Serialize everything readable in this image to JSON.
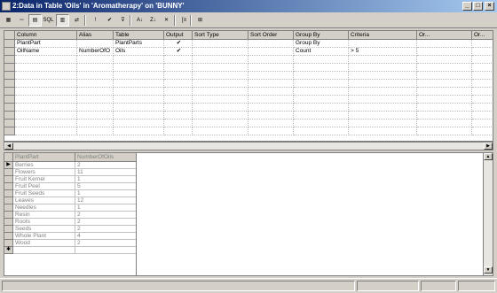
{
  "window": {
    "title": "2:Data in Table 'Oils' in 'Aromatherapy' on 'BUNNY'",
    "minimize": "_",
    "maximize": "□",
    "close": "×"
  },
  "toolbar": {
    "buttons": [
      {
        "name": "design-icon",
        "label": "▦"
      },
      {
        "name": "diagram-icon",
        "label": "▫▫"
      },
      {
        "name": "grid-pane-icon",
        "label": "▤"
      },
      {
        "name": "sql-pane-icon",
        "label": "SQL"
      },
      {
        "name": "results-pane-icon",
        "label": "▥"
      },
      {
        "name": "change-type-icon",
        "label": "⇄"
      },
      {
        "name": "run-icon",
        "label": "!"
      },
      {
        "name": "verify-sql-icon",
        "label": "✔"
      },
      {
        "name": "filter-icon",
        "label": "⊽"
      },
      {
        "name": "sort-asc-icon",
        "label": "A↓"
      },
      {
        "name": "sort-desc-icon",
        "label": "Z↓"
      },
      {
        "name": "remove-filter-icon",
        "label": "✕"
      },
      {
        "name": "group-by-icon",
        "label": "[≡"
      },
      {
        "name": "add-table-icon",
        "label": "⊞"
      }
    ]
  },
  "criteria_grid": {
    "columns": [
      "Column",
      "Alias",
      "Table",
      "Output",
      "Sort Type",
      "Sort Order",
      "Group By",
      "Criteria",
      "Or...",
      "Or..."
    ],
    "rows": [
      [
        "PlantPart",
        "",
        "PlantParts",
        "✔",
        "",
        "",
        "Group By",
        "",
        "",
        ""
      ],
      [
        "OilName",
        "NumberOfO",
        "Oils",
        "✔",
        "",
        "",
        "Count",
        "> 5",
        "",
        ""
      ]
    ]
  },
  "results": {
    "columns": [
      "PlantPart",
      "NumberOfOils"
    ],
    "rows": [
      [
        "Berries",
        "2"
      ],
      [
        "Flowers",
        "11"
      ],
      [
        "Fruit Kernel",
        "1"
      ],
      [
        "Fruit Peel",
        "5"
      ],
      [
        "Fruit Seeds",
        "1"
      ],
      [
        "Leaves",
        "12"
      ],
      [
        "Needles",
        "1"
      ],
      [
        "Resin",
        "2"
      ],
      [
        "Roots",
        "2"
      ],
      [
        "Seeds",
        "2"
      ],
      [
        "Whole Plant",
        "4"
      ],
      [
        "Wood",
        "2"
      ]
    ]
  }
}
